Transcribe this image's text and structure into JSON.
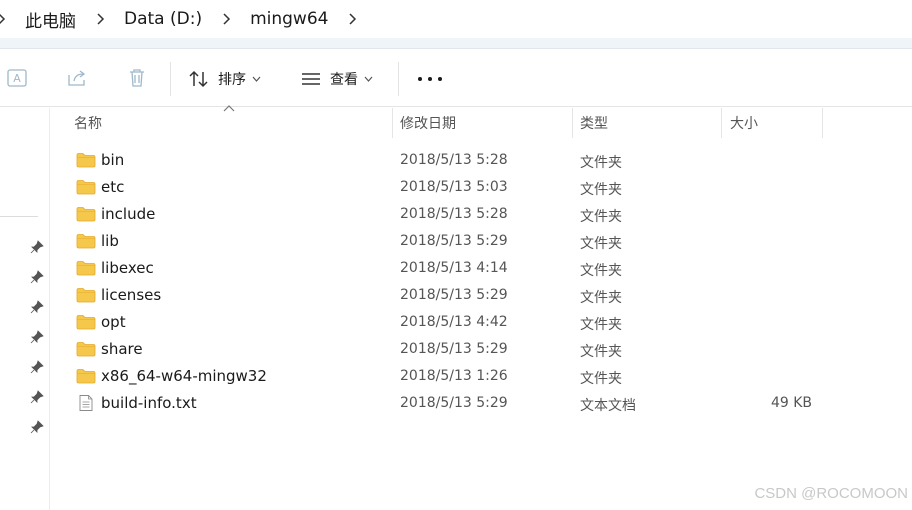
{
  "breadcrumb": {
    "items": [
      "此电脑",
      "Data (D:)",
      "mingw64"
    ]
  },
  "toolbar": {
    "sort_label": "排序",
    "view_label": "查看",
    "icons": [
      "rename-icon",
      "share-icon",
      "delete-icon",
      "sort-icon",
      "view-icon",
      "more-icon"
    ]
  },
  "columns": {
    "name": "名称",
    "date": "修改日期",
    "type": "类型",
    "size": "大小"
  },
  "files": [
    {
      "name": "bin",
      "date": "2018/5/13 5:28",
      "type": "文件夹",
      "size": "",
      "icon": "folder-icon"
    },
    {
      "name": "etc",
      "date": "2018/5/13 5:03",
      "type": "文件夹",
      "size": "",
      "icon": "folder-icon"
    },
    {
      "name": "include",
      "date": "2018/5/13 5:28",
      "type": "文件夹",
      "size": "",
      "icon": "folder-icon"
    },
    {
      "name": "lib",
      "date": "2018/5/13 5:29",
      "type": "文件夹",
      "size": "",
      "icon": "folder-icon"
    },
    {
      "name": "libexec",
      "date": "2018/5/13 4:14",
      "type": "文件夹",
      "size": "",
      "icon": "folder-icon"
    },
    {
      "name": "licenses",
      "date": "2018/5/13 5:29",
      "type": "文件夹",
      "size": "",
      "icon": "folder-icon"
    },
    {
      "name": "opt",
      "date": "2018/5/13 4:42",
      "type": "文件夹",
      "size": "",
      "icon": "folder-icon"
    },
    {
      "name": "share",
      "date": "2018/5/13 5:29",
      "type": "文件夹",
      "size": "",
      "icon": "folder-icon"
    },
    {
      "name": "x86_64-w64-mingw32",
      "date": "2018/5/13 1:26",
      "type": "文件夹",
      "size": "",
      "icon": "folder-icon"
    },
    {
      "name": "build-info.txt",
      "date": "2018/5/13 5:29",
      "type": "文本文档",
      "size": "49 KB",
      "icon": "text-file-icon"
    }
  ],
  "watermark": "CSDN @ROCOMOON",
  "colors": {
    "folder": "#f5c84c",
    "folder_dark": "#e4a92a",
    "disabled_icon": "#9fb8cc"
  }
}
